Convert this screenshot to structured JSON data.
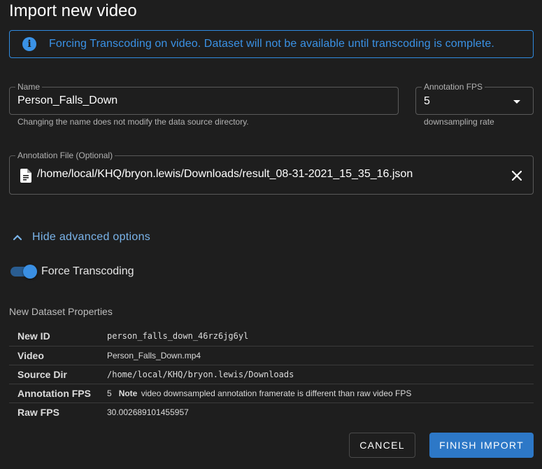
{
  "dialog": {
    "title": "Import new video"
  },
  "alert": {
    "icon": "info-icon",
    "text": "Forcing Transcoding on video. Dataset will not be available until transcoding is complete.",
    "color": "#3a92e6"
  },
  "name_field": {
    "label": "Name",
    "value": "Person_Falls_Down",
    "hint": "Changing the name does not modify the data source directory."
  },
  "fps_field": {
    "label": "Annotation FPS",
    "value": "5",
    "hint": "downsampling rate"
  },
  "annotation_file": {
    "label": "Annotation File (Optional)",
    "value": "/home/local/KHQ/bryon.lewis/Downloads/result_08-31-2021_15_35_16.json"
  },
  "advanced": {
    "label": "Hide advanced options",
    "expanded": true
  },
  "force_transcoding": {
    "label": "Force Transcoding",
    "enabled": true
  },
  "properties": {
    "title": "New Dataset Properties",
    "rows": [
      {
        "key": "New ID",
        "value": "person_falls_down_46rz6jg6yl"
      },
      {
        "key": "Video",
        "value": "Person_Falls_Down.mp4"
      },
      {
        "key": "Source Dir",
        "value": "/home/local/KHQ/bryon.lewis/Downloads"
      },
      {
        "key": "Annotation FPS",
        "value": "5",
        "note_label": "Note",
        "note_text": "video downsampled annotation framerate is different than raw video FPS"
      },
      {
        "key": "Raw FPS",
        "value": "30.002689101455957"
      }
    ]
  },
  "actions": {
    "cancel": "Cancel",
    "finish": "Finish Import"
  },
  "colors": {
    "accent": "#2d78c7",
    "background": "#1e1e1e"
  }
}
